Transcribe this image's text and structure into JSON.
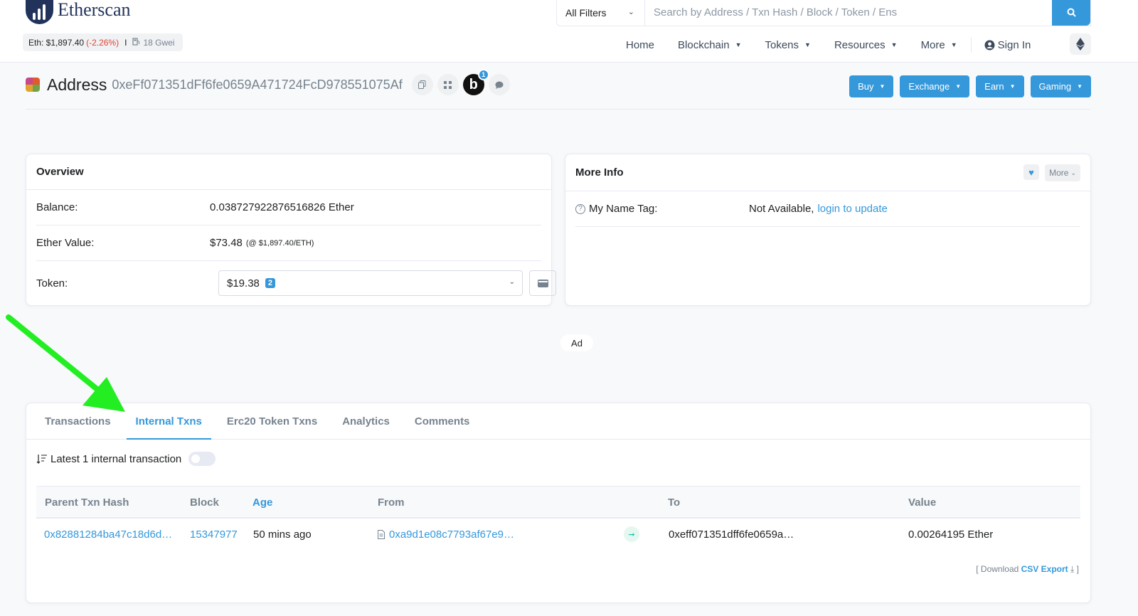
{
  "header": {
    "brand": "Etherscan",
    "eth_price": "Eth: $1,897.40",
    "eth_change": "(-2.26%)",
    "separator": "I",
    "gas": "18 Gwei",
    "filter_label": "All Filters",
    "search_placeholder": "Search by Address / Txn Hash / Block / Token / Ens",
    "nav": {
      "home": "Home",
      "blockchain": "Blockchain",
      "tokens": "Tokens",
      "resources": "Resources",
      "more": "More",
      "sign_in": "Sign In"
    }
  },
  "address": {
    "label": "Address",
    "hash": "0xeFf071351dFf6fe0659A471724FcD978551075Af",
    "badge_letter": "b",
    "badge_count": "1",
    "actions": [
      "Buy",
      "Exchange",
      "Earn",
      "Gaming"
    ]
  },
  "overview": {
    "title": "Overview",
    "balance_label": "Balance:",
    "balance_value": "0.038727922876516826 Ether",
    "ether_value_label": "Ether Value:",
    "ether_value": "$73.48",
    "ether_rate": "(@ $1,897.40/ETH)",
    "token_label": "Token:",
    "token_value": "$19.38",
    "token_count": "2"
  },
  "more_info": {
    "title": "More Info",
    "more_button": "More",
    "name_tag_label": "My Name Tag:",
    "name_tag_value": "Not Available,",
    "name_tag_link": "login to update"
  },
  "ad_label": "Ad",
  "txns": {
    "tabs": [
      "Transactions",
      "Internal Txns",
      "Erc20 Token Txns",
      "Analytics",
      "Comments"
    ],
    "active_tab": "Internal Txns",
    "summary": "Latest 1 internal transaction",
    "columns": [
      "Parent Txn Hash",
      "Block",
      "Age",
      "From",
      "To",
      "Value"
    ],
    "rows": [
      {
        "parent_hash": "0x82881284ba47c18d6d…",
        "block": "15347977",
        "age": "50 mins ago",
        "from": "0xa9d1e08c7793af67e9…",
        "to": "0xeff071351dff6fe0659a…",
        "value": "0.00264195 Ether"
      }
    ],
    "download_prefix": "[ Download",
    "download_link": "CSV Export",
    "download_suffix": "]"
  },
  "colors": {
    "accent": "#3498db",
    "brand": "#21325b",
    "negative": "#de4437",
    "annotation_arrow": "#22ee22"
  },
  "icons": [
    "search-icon",
    "user-circle-icon",
    "ethereum-icon",
    "copy-icon",
    "qr-code-icon",
    "chat-icon",
    "wallet-icon",
    "heart-icon",
    "question-icon",
    "sort-icon",
    "document-icon",
    "arrow-right-icon",
    "download-icon",
    "chevron-down-icon"
  ]
}
